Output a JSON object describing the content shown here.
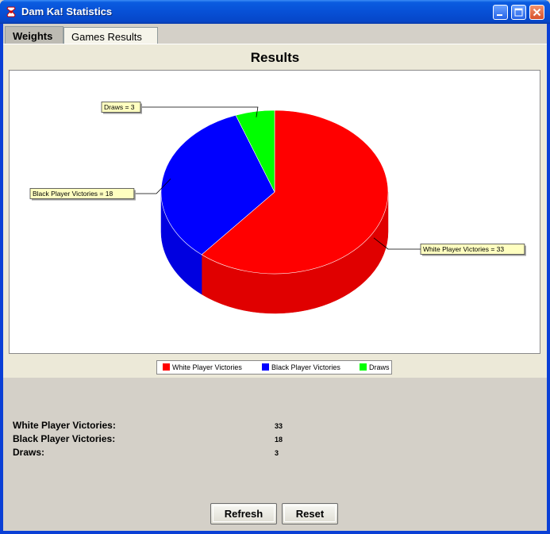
{
  "window": {
    "title": "Dam Ka! Statistics",
    "icon": "app-logo-icon",
    "controls": [
      "minimize-icon",
      "maximize-icon",
      "close-icon"
    ]
  },
  "tabs": [
    {
      "label": "Weights",
      "selected": true
    },
    {
      "label": "Games Results",
      "selected": false
    }
  ],
  "chart_data": {
    "type": "pie",
    "style": "3d",
    "title": "Results",
    "categories": [
      "White Player Victories",
      "Black Player Victories",
      "Draws"
    ],
    "values": [
      33,
      18,
      3
    ],
    "colors": [
      "#ff0000",
      "#0000ff",
      "#00ff00"
    ],
    "label_sep": " = ",
    "legend_placement": "bottom"
  },
  "stats": [
    {
      "label": "White Player Victories:",
      "value": "33"
    },
    {
      "label": "Black Player Victories:",
      "value": "18"
    },
    {
      "label": "Draws:",
      "value": "3"
    }
  ],
  "buttons": {
    "refresh": "Refresh",
    "reset": "Reset"
  }
}
